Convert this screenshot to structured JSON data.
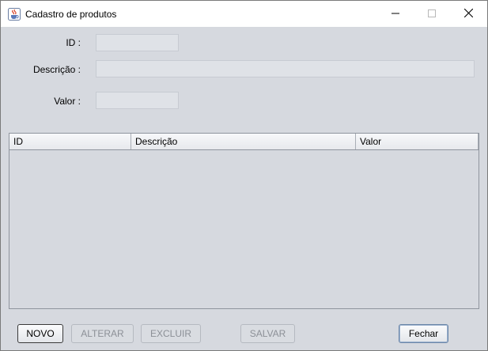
{
  "window": {
    "title": "Cadastro de produtos",
    "icons": {
      "app": "java-cup-icon",
      "minimize": "minimize-icon",
      "maximize": "maximize-icon",
      "close": "close-icon"
    }
  },
  "form": {
    "id_label": "ID :",
    "id_value": "",
    "descricao_label": "Descrição :",
    "descricao_value": "",
    "valor_label": "Valor :",
    "valor_value": ""
  },
  "table": {
    "columns": [
      "ID",
      "Descrição",
      "Valor"
    ],
    "rows": []
  },
  "buttons": {
    "novo": {
      "label": "NOVO",
      "enabled": true
    },
    "alterar": {
      "label": "ALTERAR",
      "enabled": false
    },
    "excluir": {
      "label": "EXCLUIR",
      "enabled": false
    },
    "salvar": {
      "label": "SALVAR",
      "enabled": false
    },
    "fechar": {
      "label": "Fechar",
      "enabled": true
    }
  }
}
